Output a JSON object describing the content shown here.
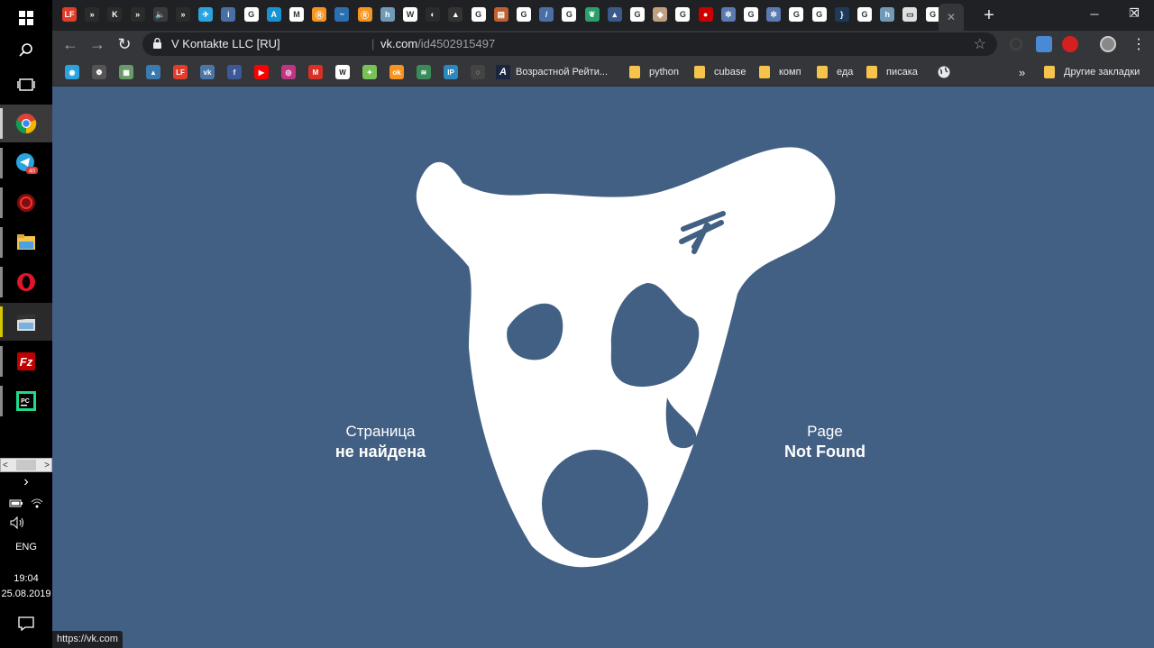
{
  "tabstrip": {
    "favicons": [
      {
        "name": "lf",
        "color": "#e23c2a",
        "label": "LF"
      },
      {
        "name": "yandex-zen",
        "color": "#2b2b2b",
        "label": "»"
      },
      {
        "name": "kx",
        "color": "#2b2b2b",
        "label": "K"
      },
      {
        "name": "yandex-zen",
        "color": "#2b2b2b",
        "label": "»"
      },
      {
        "name": "audio",
        "color": "#3a3a3a",
        "label": "🔈"
      },
      {
        "name": "yandex-zen",
        "color": "#2b2b2b",
        "label": "»"
      },
      {
        "name": "telegram",
        "color": "#2aa3df",
        "label": "✈"
      },
      {
        "name": "info",
        "color": "#4a6fa5",
        "label": "i"
      },
      {
        "name": "google",
        "color": "#ffffff",
        "label": "G"
      },
      {
        "name": "arch",
        "color": "#1793d1",
        "label": "A"
      },
      {
        "name": "medium",
        "color": "#ffffff",
        "label": "M"
      },
      {
        "name": "ok",
        "color": "#f7931e",
        "label": "Ⓡ"
      },
      {
        "name": "bird",
        "color": "#2b6fb0",
        "label": "~"
      },
      {
        "name": "ok2",
        "color": "#f7931e",
        "label": "Ⓡ"
      },
      {
        "name": "habr",
        "color": "#6f9ab8",
        "label": "h"
      },
      {
        "name": "wiki",
        "color": "#ffffff",
        "label": "W"
      },
      {
        "name": "dark",
        "color": "#2b2b2b",
        "label": "◐"
      },
      {
        "name": "triangle",
        "color": "#333333",
        "label": "▲"
      },
      {
        "name": "google",
        "color": "#ffffff",
        "label": "G"
      },
      {
        "name": "book",
        "color": "#c06030",
        "label": "▤"
      },
      {
        "name": "google",
        "color": "#ffffff",
        "label": "G"
      },
      {
        "name": "slash",
        "color": "#4a6fa5",
        "label": "/"
      },
      {
        "name": "google",
        "color": "#ffffff",
        "label": "G"
      },
      {
        "name": "leaf",
        "color": "#2aa06a",
        "label": "❦"
      },
      {
        "name": "cap",
        "color": "#3a5a8a",
        "label": "▴"
      },
      {
        "name": "google",
        "color": "#ffffff",
        "label": "G"
      },
      {
        "name": "cube",
        "color": "#c0a080",
        "label": "◆"
      },
      {
        "name": "google",
        "color": "#ffffff",
        "label": "G"
      },
      {
        "name": "redhat",
        "color": "#cc0000",
        "label": "●"
      },
      {
        "name": "gear",
        "color": "#5a7ab0",
        "label": "✲"
      },
      {
        "name": "google",
        "color": "#ffffff",
        "label": "G"
      },
      {
        "name": "gear",
        "color": "#5a7ab0",
        "label": "✲"
      },
      {
        "name": "google",
        "color": "#ffffff",
        "label": "G"
      },
      {
        "name": "google",
        "color": "#ffffff",
        "label": "G"
      },
      {
        "name": "brackets",
        "color": "#1e3a5a",
        "label": "}"
      },
      {
        "name": "google",
        "color": "#ffffff",
        "label": "G"
      },
      {
        "name": "habr",
        "color": "#6f9ab8",
        "label": "h"
      },
      {
        "name": "doc",
        "color": "#e0e0e0",
        "label": "▭"
      },
      {
        "name": "google",
        "color": "#ffffff",
        "label": "G"
      }
    ],
    "close_icon": "✕",
    "new_tab_icon": "+"
  },
  "window_controls": {
    "minimize": "─",
    "restore": "❐",
    "close": "✕"
  },
  "toolbar": {
    "back_icon": "←",
    "forward_icon": "→",
    "reload_icon": "↻",
    "site_name": "V Kontakte LLC [RU]",
    "url_host": "vk.com",
    "url_path": "/id4502915497",
    "star_icon": "☆"
  },
  "bookmarks": {
    "icons": [
      {
        "name": "bm1",
        "color": "#2aa3df",
        "label": "◉"
      },
      {
        "name": "bm2",
        "color": "#555555",
        "label": "❁"
      },
      {
        "name": "bm3",
        "color": "#6a9a6a",
        "label": "▦"
      },
      {
        "name": "bm4",
        "color": "#3a7ab0",
        "label": "▲"
      },
      {
        "name": "bm5",
        "color": "#e23c2a",
        "label": "LF"
      },
      {
        "name": "vk",
        "color": "#4a76a8",
        "label": "vk"
      },
      {
        "name": "facebook",
        "color": "#3b5998",
        "label": "f"
      },
      {
        "name": "youtube",
        "color": "#ff0000",
        "label": "▶"
      },
      {
        "name": "instagram",
        "color": "#c13584",
        "label": "◎"
      },
      {
        "name": "gmail",
        "color": "#d93025",
        "label": "M"
      },
      {
        "name": "wiki",
        "color": "#ffffff",
        "label": "W"
      },
      {
        "name": "android",
        "color": "#78c257",
        "label": "✦"
      },
      {
        "name": "ok",
        "color": "#f7931e",
        "label": "ok"
      },
      {
        "name": "bm14",
        "color": "#3a8a5a",
        "label": "≋"
      },
      {
        "name": "ip",
        "color": "#2a8ac0",
        "label": "IP"
      },
      {
        "name": "bm16",
        "color": "#444444",
        "label": "◌"
      }
    ],
    "rating_label": "Возрастной Рейти...",
    "folders": [
      "python",
      "cubase",
      "комп",
      "еда",
      "писака"
    ],
    "more_icon": "»",
    "other_label": "Другие закладки"
  },
  "page": {
    "left_line1": "Страница",
    "left_line2": "не найдена",
    "right_line1": "Page",
    "right_line2": "Not Found",
    "bg_color": "#426084"
  },
  "status_url": "https://vk.com",
  "taskbar": {
    "lang": "ENG",
    "time": "19:04",
    "date": "25.08.2019",
    "scroll_left": "<",
    "scroll_right": ">",
    "expand": "›"
  }
}
